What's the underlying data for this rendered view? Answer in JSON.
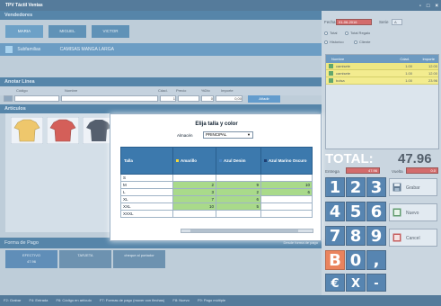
{
  "window": {
    "title": "TPV Táctil Ventas",
    "controls": [
      "-",
      "□",
      "×"
    ]
  },
  "vendedores": {
    "header": "Vendedores",
    "tabs": [
      "MARIA",
      "MIGUEL",
      "VICTOR"
    ]
  },
  "sub_header": {
    "label": "Subfamilias",
    "category": "CAMISAS MANGA LARGA"
  },
  "anotar": {
    "header": "Anotar Línea",
    "columns": [
      "Código",
      "Nombre",
      "Cdad.",
      "Precio",
      "%Dto",
      "Importe"
    ],
    "row_values": {
      "cdad": "1",
      "dto": "0",
      "importe": "0,00"
    },
    "add_button": "Añadir"
  },
  "articulos": {
    "header": "Artículos"
  },
  "forma_pago": {
    "header": "Forma de Pago",
    "link": "Desde forma de pago",
    "buttons": [
      {
        "label": "EFECTIVO",
        "amount": "47.96"
      },
      {
        "label": "TARJETA",
        "amount": ""
      },
      {
        "label": "cheque al portador",
        "amount": ""
      }
    ]
  },
  "footer": {
    "items": [
      "F2: Grabar",
      "F4: Entrada",
      "F6: Código en artículo",
      "F7: Formas de pago (mover con flechas)",
      "F8: Nuevo",
      "F9: Pago múltiple"
    ]
  },
  "right": {
    "fecha_label": "Fecha",
    "fecha_value": "01-06-2016",
    "serie_label": "Serie",
    "serie_value": "A",
    "total_label": "Total",
    "total_reg_label": "Total Regalo",
    "radio1": "Historico",
    "radio2": "Cliente",
    "list_headers": [
      "Nombre",
      "Cdad.",
      "Importe"
    ],
    "lines": [
      {
        "name": "camisete",
        "qty": "1.00",
        "amount": "12.00"
      },
      {
        "name": "camisete",
        "qty": "1.00",
        "amount": "12.00"
      },
      {
        "name": "bolsa",
        "qty": "1.00",
        "amount": "23.96"
      }
    ],
    "total_text": "TOTAL:",
    "total_value": "47.96",
    "entregado_label": "Entrega",
    "entregado_value": "47.96",
    "vuelta_label": "Vuelta",
    "vuelta_value": "0.0"
  },
  "keypad": {
    "keys": [
      "1",
      "2",
      "3",
      "4",
      "5",
      "6",
      "7",
      "8",
      "9",
      "B",
      "0",
      ",",
      "€",
      "X",
      "-"
    ]
  },
  "actions": {
    "grabar": "Grabar",
    "nuevo": "Nuevo",
    "cancel": "Cancel"
  },
  "modal": {
    "title": "Elija talla y color",
    "almacen_label": "Almacén",
    "almacen_value": "PRINCIPAL",
    "columns": [
      "Talla",
      "Amarillo",
      "Azul Denim",
      "Azul Marino Oscuro"
    ],
    "column_colors": [
      "#f2d63a",
      "#4b86c6",
      "#1f3f73"
    ],
    "rows": [
      {
        "talla": "S",
        "values": [
          "",
          "",
          ""
        ]
      },
      {
        "talla": "M",
        "values": [
          "2",
          "9",
          "10"
        ]
      },
      {
        "talla": "L",
        "values": [
          "3",
          "2",
          "6"
        ]
      },
      {
        "talla": "XL",
        "values": [
          "7",
          "6",
          ""
        ]
      },
      {
        "talla": "XXL",
        "values": [
          "10",
          "5",
          ""
        ]
      },
      {
        "talla": "XXXL",
        "values": [
          "",
          "",
          ""
        ]
      }
    ]
  }
}
